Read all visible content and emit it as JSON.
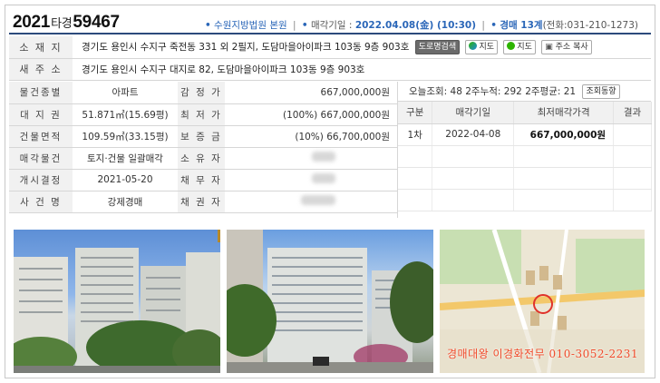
{
  "header": {
    "case_year": "2021",
    "case_kind": "타경",
    "case_number": "59467",
    "court": "수원지방법원 본원",
    "sale_date_label": "매각기일 :",
    "sale_date": "2022.04.08(金) (10:30)",
    "dept": "경매 13계",
    "phone": "(전화:031-210-1273)"
  },
  "address": {
    "location_label": "소 재 지",
    "location": "경기도 용인시 수지구 죽전동 331 외 2필지, 도담마을아이파크 103동 9층 903호",
    "new_addr_label": "새 주 소",
    "new_addr": "경기도 용인시 수지구 대지로 82, 도담마을아이파크 103동 9층 903호",
    "buttons": {
      "road": "도로명검색",
      "map1": "지도",
      "map2": "지도",
      "copy": "주소 복사"
    }
  },
  "info": {
    "rows": [
      {
        "label": "물건종별",
        "value": "아파트",
        "label2": "감 정 가",
        "value2": "667,000,000원"
      },
      {
        "label": "대 지 권",
        "value": "51.871㎡(15.69평)",
        "label2": "최 저 가",
        "value2": "(100%) 667,000,000원"
      },
      {
        "label": "건물면적",
        "value": "109.59㎡(33.15평)",
        "label2": "보 증 금",
        "value2": "(10%) 66,700,000원"
      },
      {
        "label": "매각물건",
        "value": "토지·건물 일괄매각",
        "label2": "소 유 자",
        "value2": ""
      },
      {
        "label": "개시결정",
        "value": "2021-05-20",
        "label2": "채 무 자",
        "value2": ""
      },
      {
        "label": "사 건 명",
        "value": "강제경매",
        "label2": "채 권 자",
        "value2": ""
      }
    ]
  },
  "views": {
    "today_label": "오늘조회:",
    "today": "48",
    "weeks2_label": "2주누적:",
    "weeks2": "292",
    "avg_label": "2주평균:",
    "avg": "21",
    "trend_button": "조회동향"
  },
  "rounds": {
    "headers": [
      "구분",
      "매각기일",
      "최저매각가격",
      "결과"
    ],
    "rows": [
      {
        "round": "1차",
        "date": "2022-04-08",
        "price": "667,000,000원",
        "result": ""
      }
    ]
  },
  "photos": {
    "caption": "경매대왕 이경화전무 010-3052-2231"
  },
  "colors": {
    "accent": "#2a66b8",
    "header_rule": "#2c4a7c",
    "label_bg": "#f1f1f1"
  }
}
